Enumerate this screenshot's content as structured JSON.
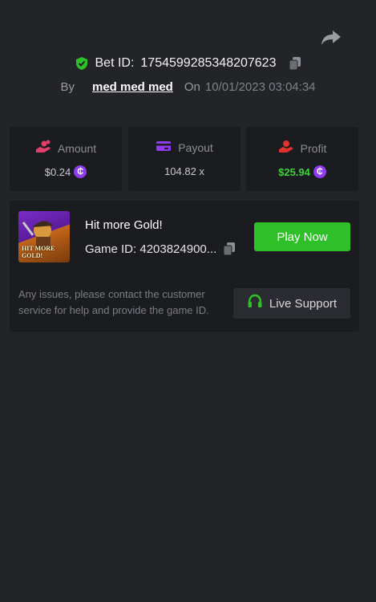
{
  "header": {
    "bet_label": "Bet ID:",
    "bet_id": "1754599285348207623",
    "by_label": "By",
    "username": "med med med",
    "on_label": "On",
    "datetime": "10/01/2023 03:04:34"
  },
  "stats": {
    "amount": {
      "label": "Amount",
      "value": "$0.24",
      "icon": "hand-coins-icon"
    },
    "payout": {
      "label": "Payout",
      "value": "104.82 x",
      "icon": "card-icon"
    },
    "profit": {
      "label": "Profit",
      "value": "$25.94",
      "icon": "hand-money-icon"
    }
  },
  "game": {
    "thumb_text": "HIT MORE GOLD!",
    "title": "Hit more Gold!",
    "id_text": "Game ID: 4203824900...",
    "play_label": "Play Now"
  },
  "support": {
    "notice": "Any issues, please contact the customer service for help and provide the game ID.",
    "button_label": "Live Support"
  },
  "coin_symbol": "₵",
  "colors": {
    "background": "#232428",
    "card": "#1b1c20",
    "green": "#2fbf28",
    "coin": "#8f3bf0",
    "profit": "#3fd13a"
  }
}
